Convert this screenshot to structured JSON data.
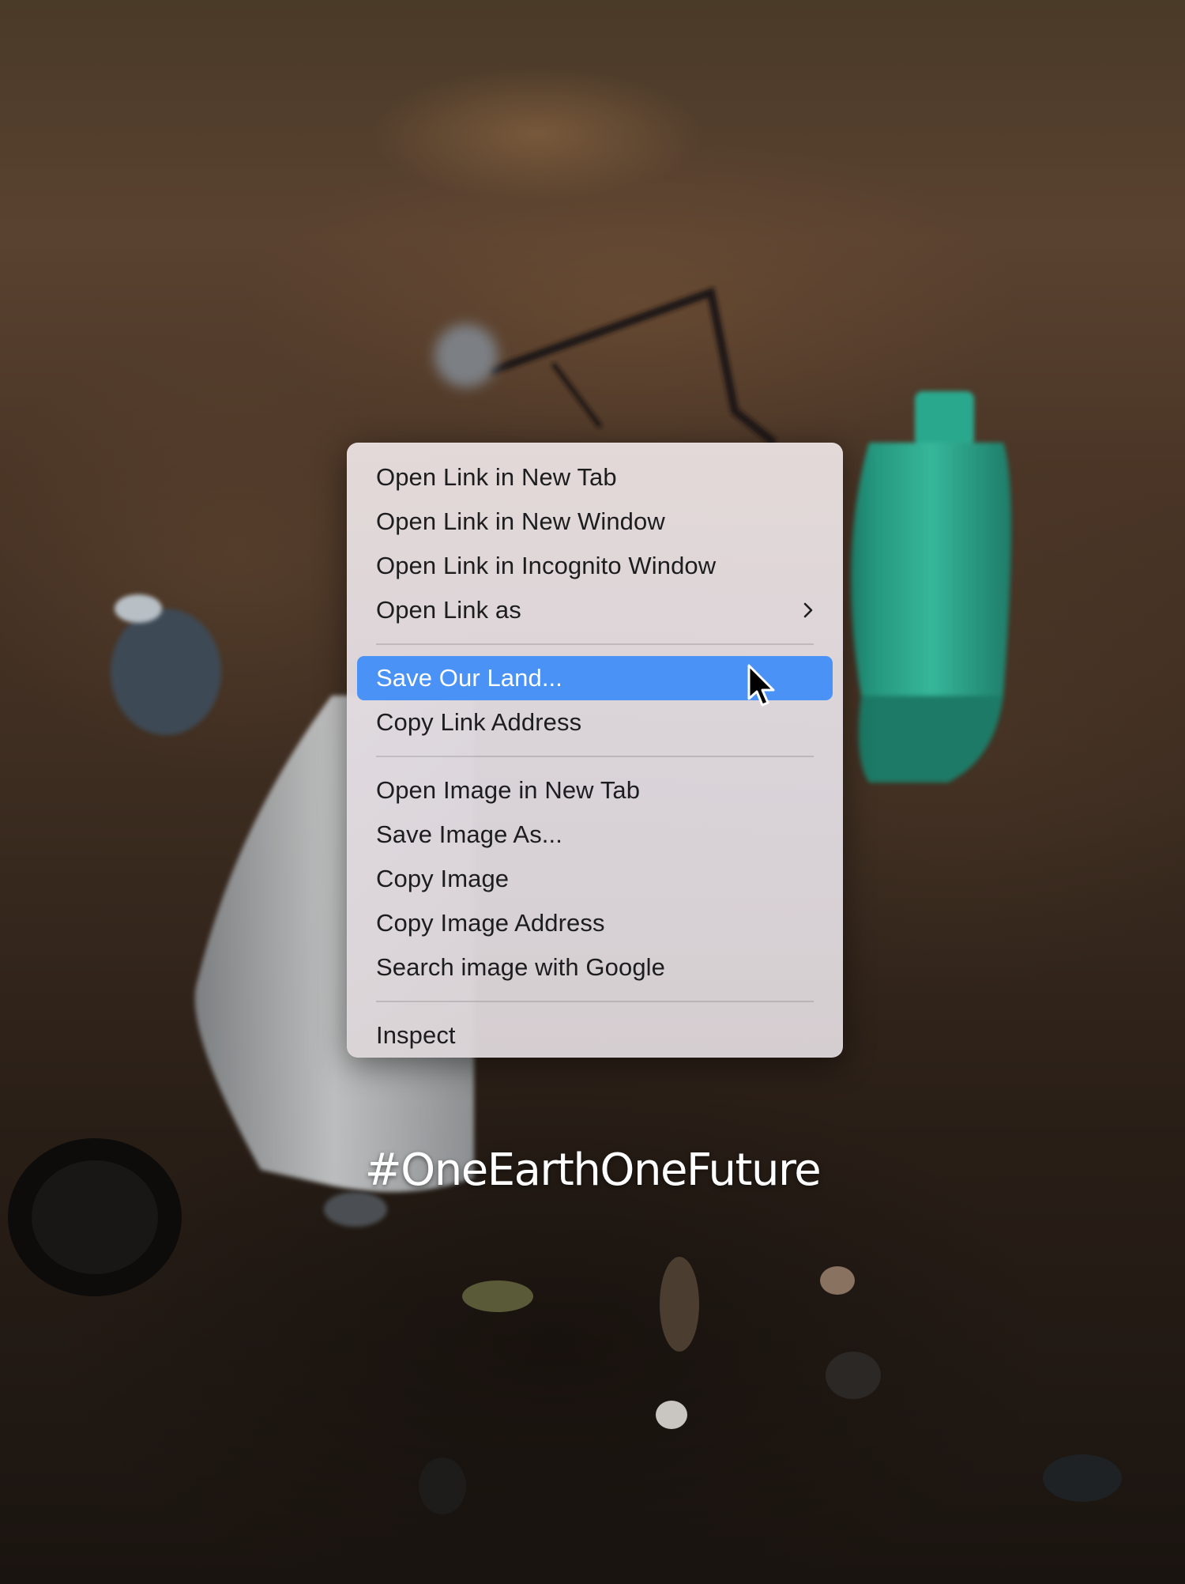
{
  "background": {
    "scene": "photo-blurred-soil-with-plastic-bottles"
  },
  "context_menu": {
    "groups": [
      {
        "items": [
          {
            "label": "Open Link in New Tab"
          },
          {
            "label": "Open Link in New Window"
          },
          {
            "label": "Open Link in Incognito Window"
          },
          {
            "label": "Open Link as",
            "submenu_icon": "chevron-right-icon"
          }
        ]
      },
      {
        "items": [
          {
            "label": "Save Our Land...",
            "highlighted": true
          },
          {
            "label": "Copy Link Address"
          }
        ]
      },
      {
        "items": [
          {
            "label": "Open Image in New Tab"
          },
          {
            "label": "Save Image As..."
          },
          {
            "label": "Copy Image"
          },
          {
            "label": "Copy Image Address"
          },
          {
            "label": "Search image with Google"
          }
        ]
      },
      {
        "items": [
          {
            "label": "Inspect"
          }
        ]
      }
    ],
    "highlight_color": "#4a92f5"
  },
  "caption": {
    "hashtag": "#OneEarthOneFuture"
  },
  "cursor": {
    "icon": "pointer-arrow-icon"
  }
}
